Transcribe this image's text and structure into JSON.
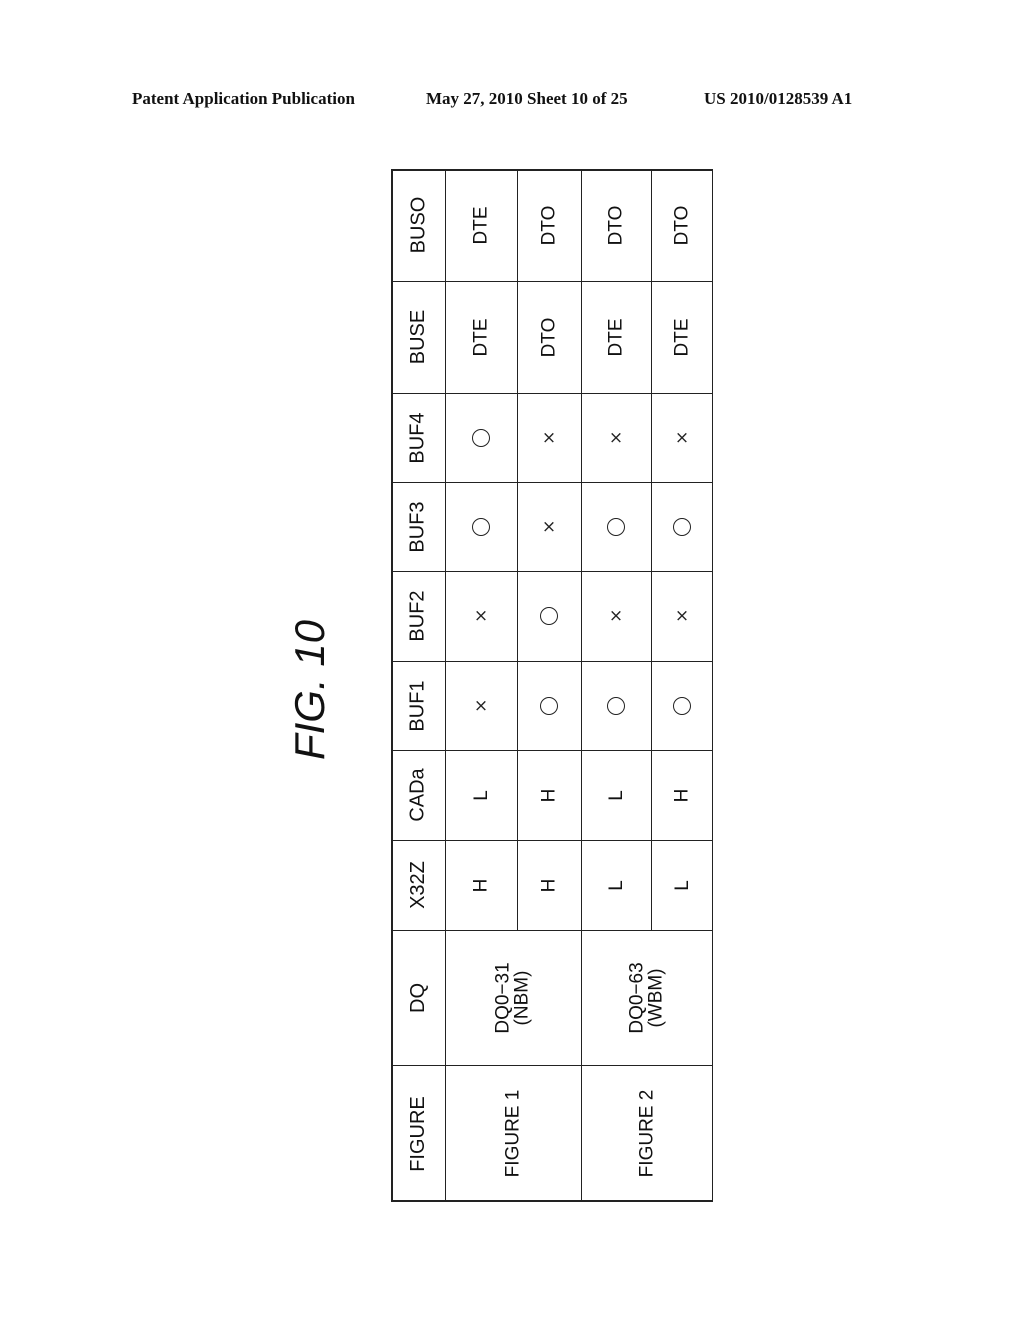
{
  "header": {
    "publication": "Patent Application Publication",
    "date_sheet": "May 27, 2010  Sheet 10 of 25",
    "number": "US 2010/0128539 A1"
  },
  "figure_title": "FIG. 10",
  "table": {
    "columns": [
      "FIGURE",
      "DQ",
      "X32Z",
      "CADa",
      "BUF1",
      "BUF2",
      "BUF3",
      "BUF4",
      "BUSE",
      "BUSO"
    ],
    "groups": [
      {
        "figure": "FIGURE 1",
        "dq_line1": "DQ0−31",
        "dq_line2": "(NBM)"
      },
      {
        "figure": "FIGURE 2",
        "dq_line1": "DQ0−63",
        "dq_line2": "(WBM)"
      }
    ],
    "rows": [
      {
        "X32Z": "H",
        "CADa": "L",
        "BUF1": "x",
        "BUF2": "x",
        "BUF3": "o",
        "BUF4": "o",
        "BUSE": "DTE",
        "BUSO": "DTE"
      },
      {
        "X32Z": "H",
        "CADa": "H",
        "BUF1": "o",
        "BUF2": "o",
        "BUF3": "x",
        "BUF4": "x",
        "BUSE": "DTO",
        "BUSO": "DTO"
      },
      {
        "X32Z": "L",
        "CADa": "L",
        "BUF1": "o",
        "BUF2": "x",
        "BUF3": "o",
        "BUF4": "x",
        "BUSE": "DTE",
        "BUSO": "DTO"
      },
      {
        "X32Z": "L",
        "CADa": "H",
        "BUF1": "o",
        "BUF2": "x",
        "BUF3": "o",
        "BUF4": "x",
        "BUSE": "DTE",
        "BUSO": "DTO"
      }
    ],
    "legend": {
      "o": "circle-mark",
      "x": "cross-mark"
    }
  }
}
